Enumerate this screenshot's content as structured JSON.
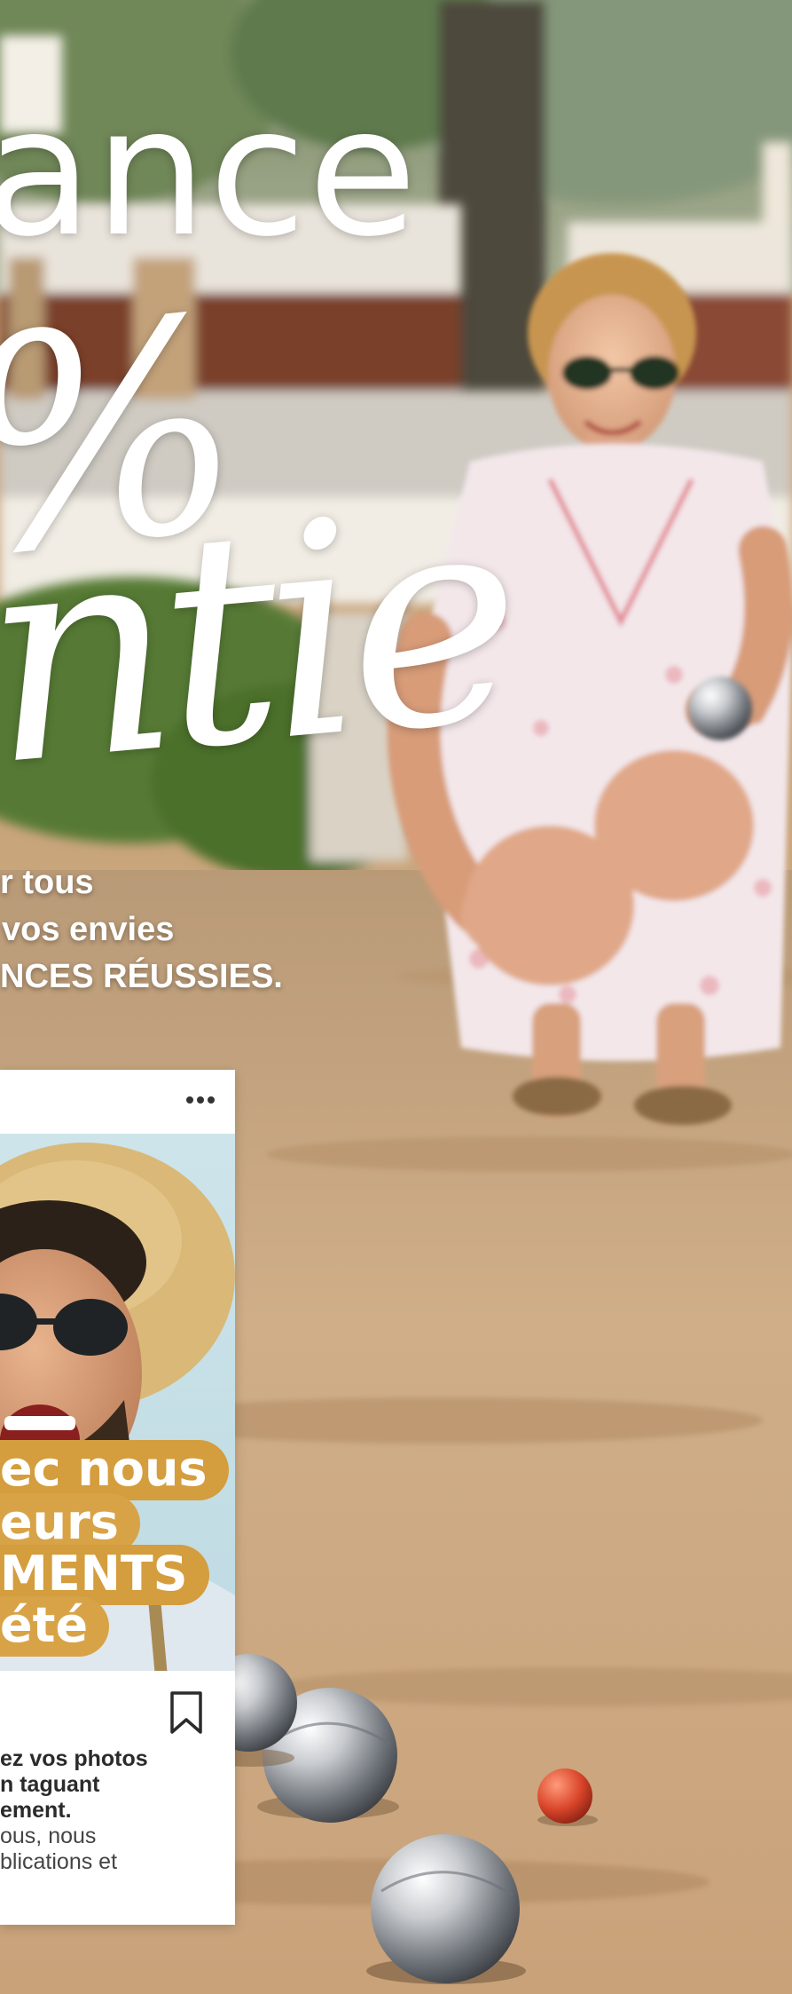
{
  "headline": {
    "line1": "ance",
    "line2": "%",
    "line3": "ntie"
  },
  "subtitle": {
    "lines": [
      "r tous",
      "vos envies",
      "NCES RÉUSSIES."
    ]
  },
  "post_card": {
    "banners": [
      "ec nous",
      "eurs",
      "MENTS",
      "été"
    ],
    "caption_bold": [
      "ez vos photos",
      "n taguant",
      "ement."
    ],
    "caption_regular": [
      "ous, nous",
      "blications et"
    ]
  },
  "icons": {
    "more": "more-horizontal-icon",
    "bookmark": "bookmark-icon"
  },
  "colors": {
    "banner_orange": "#d49d3d",
    "text_white": "#ffffff",
    "sand": "#c9a57c"
  }
}
